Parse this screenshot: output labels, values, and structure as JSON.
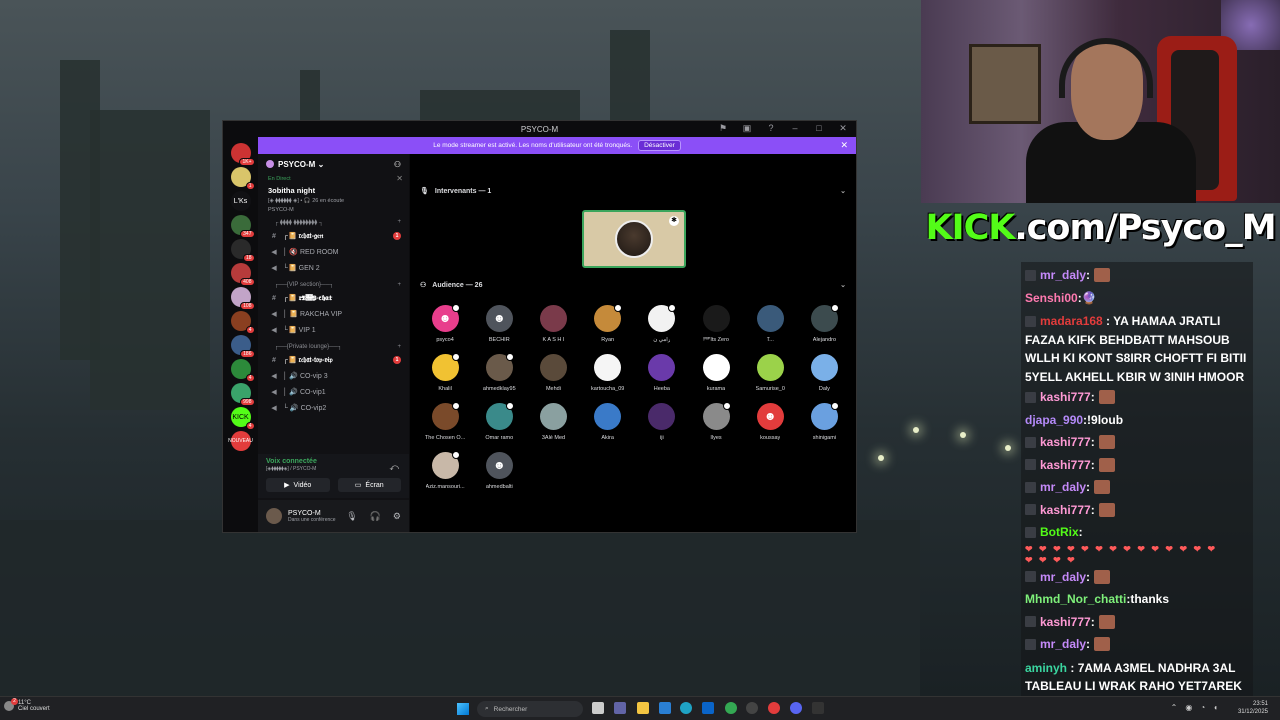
{
  "discord": {
    "title": "PSYCO-M",
    "banner": {
      "text": "Le mode streamer est activé. Les noms d'utilisateur ont été tronqués.",
      "button": "Désactiver"
    },
    "server_rail": [
      {
        "badge": "1K+",
        "color": "#c33"
      },
      {
        "badge": "1",
        "color": "#d9c56a"
      },
      {
        "label": "L'Ks",
        "color": "#111114"
      },
      {
        "badge": "347",
        "color": "#3a6b3a"
      },
      {
        "badge": "18",
        "color": "#2a2a2a"
      },
      {
        "badge": "408",
        "color": "#b63b3b"
      },
      {
        "badge": "108",
        "color": "#c2a4c8"
      },
      {
        "badge": "4",
        "color": "#8a3f20"
      },
      {
        "badge": "186",
        "color": "#3b5d8a"
      },
      {
        "badge": "4",
        "color": "#2c8a3a"
      },
      {
        "badge": "998",
        "color": "#3aa36a"
      },
      {
        "label": "KICK",
        "badge": "4",
        "color": "#53fc18"
      },
      {
        "label": "NOUVEAU",
        "color": "#e23c3c"
      }
    ],
    "guild_name": "PSYCO-M",
    "event": {
      "live": "En Direct",
      "name": "3obitha night",
      "meta": "[◈ ⧫⧫⧫⧫⧫⧫ ◈] • 🎧 26 en écoute",
      "host": "PSYCO-M"
    },
    "categories": [
      {
        "name": "┌ ⧫⧫⧫⧫ ⧫⧫⧫⧫⧫⧫⧫⧫ ┐",
        "channels": [
          {
            "type": "text",
            "name": "┌📔 𝔯𝔠𝔥𝔞𝔱-𝔤𝔢𝔫",
            "unread": "1"
          },
          {
            "type": "voice",
            "name": "│ 🔇 RED ROOM"
          },
          {
            "type": "voice",
            "name": "└📔 GEN 2"
          }
        ]
      },
      {
        "name": "┌──{VIP section}──┐",
        "channels": [
          {
            "type": "text",
            "name": "┌📔 𝔯𝔙𝔌𝔓-𝔠𝔥𝔞𝔱"
          },
          {
            "type": "voice",
            "name": "│ 📔 RAKCHA VIP"
          },
          {
            "type": "voice",
            "name": "└📔 VIP 1"
          }
        ]
      },
      {
        "name": "┌──{Private lounge}──┐",
        "channels": [
          {
            "type": "text",
            "name": "┌📔 𝔯𝔠𝔥𝔞𝔱-𝔱𝔬𝔭-𝔳𝔦𝔭",
            "unread": "1"
          },
          {
            "type": "voice",
            "name": "│ 🔊 CO-vip 3"
          },
          {
            "type": "voice",
            "name": "│ 🔊 CO-vip1"
          },
          {
            "type": "voice",
            "name": "└ 🔊 CO-vip2"
          }
        ]
      }
    ],
    "voice_panel": {
      "status": "Voix connectée",
      "sub": "[◈⧫⧫⧫⧫⧫◈] / PSYCO-M",
      "video": "Vidéo",
      "screen": "Écran"
    },
    "user": {
      "name": "PSYCO-M",
      "status": "Dans une conférence"
    },
    "speakers_header": "Intervenants — 1",
    "audience_header": "Audience — 26",
    "audience": [
      {
        "name": "psyco4",
        "color": "#e83e8c",
        "mod": true,
        "discord": true
      },
      {
        "name": "BECHIR",
        "color": "#4f545c",
        "discord": true
      },
      {
        "name": "K A S H I",
        "color": "#7a3a4a"
      },
      {
        "name": "Ryan",
        "color": "#c58a3a",
        "mod": true
      },
      {
        "name": "رامي ن",
        "color": "#f2f2f2",
        "mod": true
      },
      {
        "name": "!ᴿᴵᴾIts Zero",
        "color": "#1a1a1a"
      },
      {
        "name": "T...",
        "color": "#3a5a7a"
      },
      {
        "name": "Alejandro",
        "color": "#3c4b4e",
        "mod": true
      },
      {
        "name": "Khalil",
        "color": "#f1c232",
        "mod": true
      },
      {
        "name": "ahmedklay95",
        "color": "#6a5a4a",
        "mod": true
      },
      {
        "name": "Mehdi",
        "color": "#5a4a3a"
      },
      {
        "name": "kartoucha_09",
        "color": "#f5f5f5"
      },
      {
        "name": "Heeba",
        "color": "#6a3aaa"
      },
      {
        "name": "kurama",
        "color": "#ffffff"
      },
      {
        "name": "Samurise_0",
        "color": "#9bd24a"
      },
      {
        "name": "Daly",
        "color": "#7ab0e8"
      },
      {
        "name": "The Chosen O...",
        "color": "#7a4a2a",
        "mod": true
      },
      {
        "name": "Omar ramo",
        "color": "#3a8a8a",
        "mod": true
      },
      {
        "name": "3Alé Med",
        "color": "#8aa0a0"
      },
      {
        "name": "Akira",
        "color": "#3a7ac8"
      },
      {
        "name": "iji",
        "color": "#4a2a6a"
      },
      {
        "name": "Ilyes",
        "color": "#8a8a8a",
        "mod": true
      },
      {
        "name": "koussay",
        "color": "#e23c3c",
        "discord": true
      },
      {
        "name": "shinigami",
        "color": "#6aa0e0",
        "mod": true
      },
      {
        "name": "Aziz.mansouri...",
        "color": "#c8b8a8",
        "mod": true
      },
      {
        "name": "ahmedbalti",
        "color": "#4f545c",
        "discord": true
      }
    ]
  },
  "overlay": {
    "kick_green": "KICK",
    "kick_rest": ".com/Psyco_M"
  },
  "chat": [
    {
      "user": "mr_daly",
      "color": "#c58af9",
      "badge": true,
      "emote": true,
      "text": ""
    },
    {
      "user": "Senshi00",
      "color": "#ff7ab0",
      "text": "🔮"
    },
    {
      "user": "madara168",
      "color": "#e23c3c",
      "badge": true,
      "text": "YA HAMAA JRATLI FAZAA KIFK BEHDBATT MAHSOUB WLLH KI KONT S8IRR CHOFTT FI BITII 5YELL AKHELL KBIR W 3INIH HMOOR",
      "multi": true
    },
    {
      "user": "kashi777",
      "color": "#ff9ad5",
      "badge": true,
      "emote": true,
      "text": ""
    },
    {
      "user": "djapa_990",
      "color": "#b48af9",
      "text": "!9loub"
    },
    {
      "user": "kashi777",
      "color": "#ff9ad5",
      "badge": true,
      "emote": true,
      "text": ""
    },
    {
      "user": "kashi777",
      "color": "#ff9ad5",
      "badge": true,
      "emote": true,
      "text": ""
    },
    {
      "user": "mr_daly",
      "color": "#c58af9",
      "badge": true,
      "emote": true,
      "text": ""
    },
    {
      "user": "kashi777",
      "color": "#ff9ad5",
      "badge": true,
      "emote": true,
      "text": ""
    },
    {
      "user": "BotRix",
      "color": "#53fc18",
      "badge": true,
      "hearts": true,
      "text": ""
    },
    {
      "user": "mr_daly",
      "color": "#c58af9",
      "badge": true,
      "emote": true,
      "text": ""
    },
    {
      "user": "Mhmd_Nor_chatti",
      "color": "#7ef07a",
      "text": "thanks"
    },
    {
      "user": "kashi777",
      "color": "#ff9ad5",
      "badge": true,
      "emote": true,
      "text": ""
    },
    {
      "user": "mr_daly",
      "color": "#c58af9",
      "badge": true,
      "emote": true,
      "text": ""
    },
    {
      "user": "aminyh",
      "color": "#3ad6a0",
      "text": "7AMA A3MEL NADHRA 3AL TABLEAU LI WRAK RAHO YET7AREK",
      "multi": true
    }
  ],
  "taskbar": {
    "weather_temp": "11°C",
    "weather_desc": "Ciel couvert",
    "weather_badge": "2",
    "search": "Rechercher",
    "time": "23:51",
    "date": "31/12/2025"
  }
}
